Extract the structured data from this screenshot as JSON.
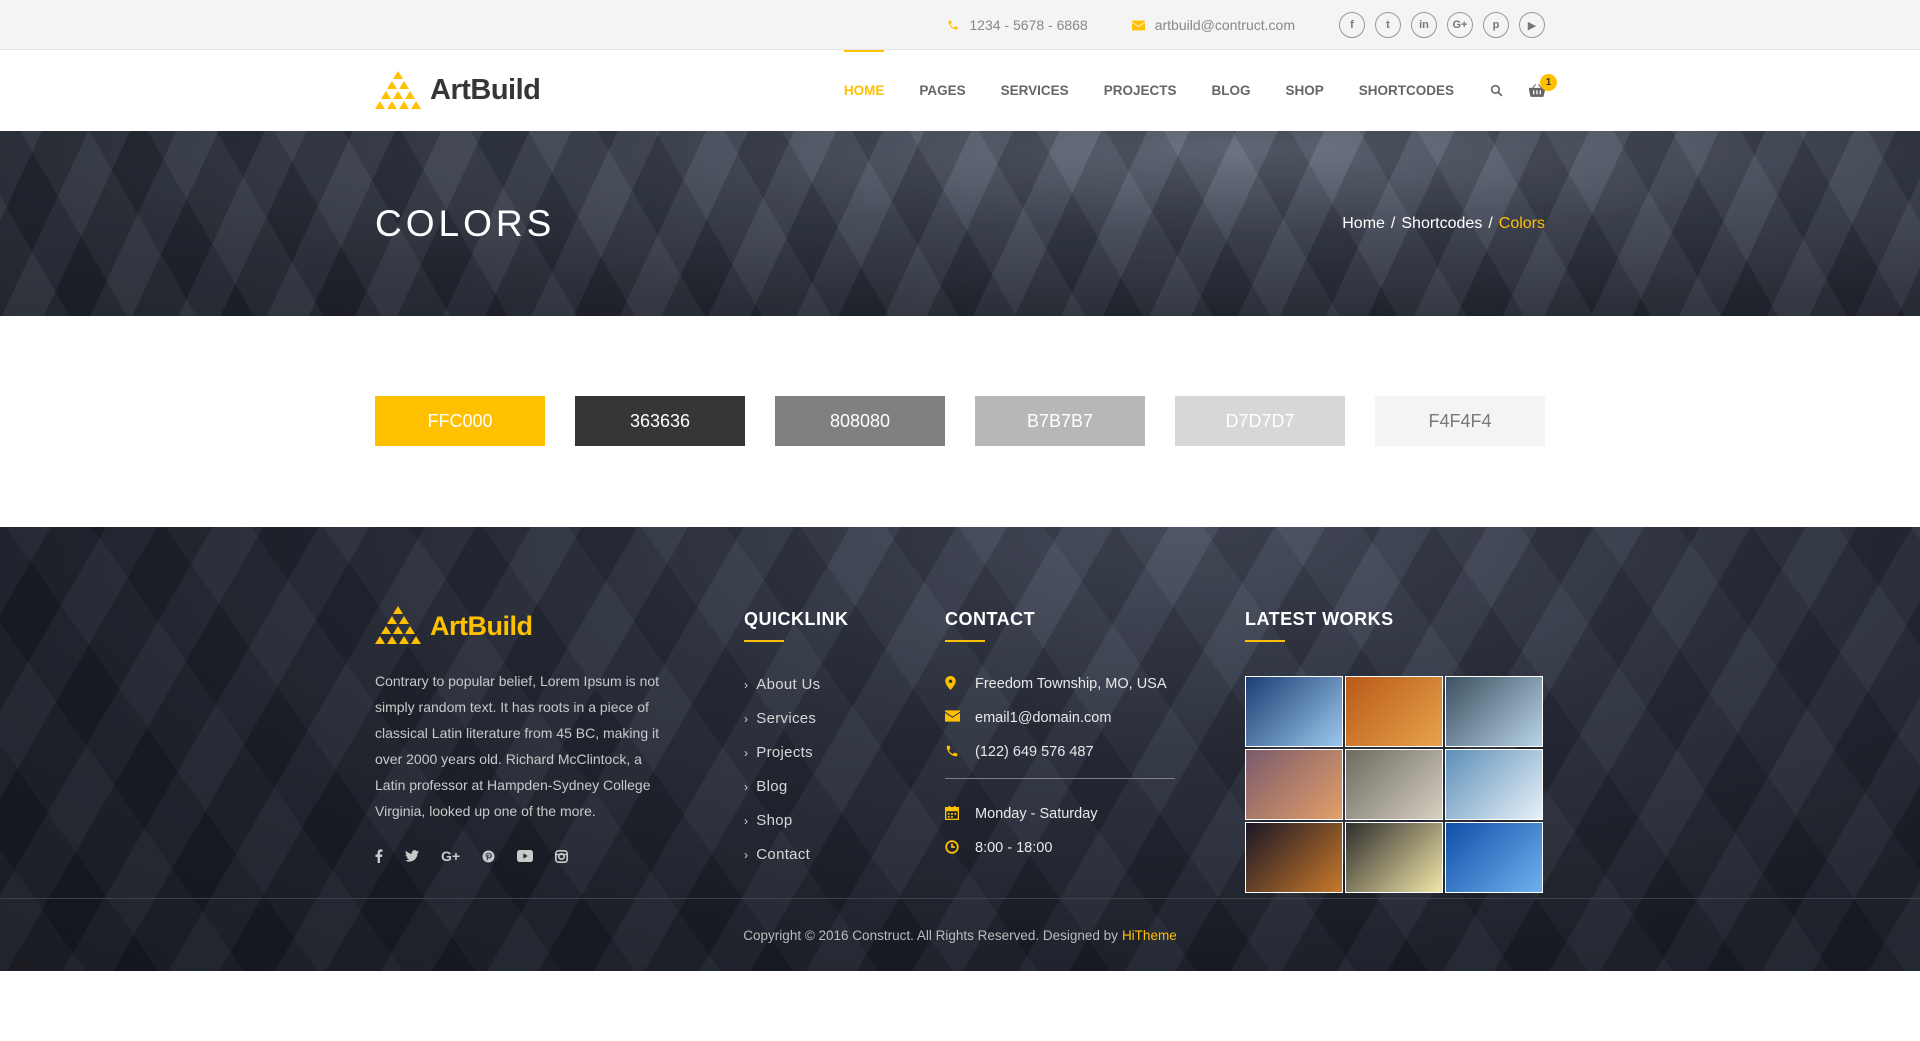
{
  "topbar": {
    "phone": "1234 - 5678 - 6868",
    "email": "artbuild@contruct.com",
    "socials": [
      {
        "icon": "facebook-icon",
        "glyph": "f"
      },
      {
        "icon": "twitter-icon",
        "glyph": "t"
      },
      {
        "icon": "linkedin-icon",
        "glyph": "in"
      },
      {
        "icon": "google-plus-icon",
        "glyph": "G+"
      },
      {
        "icon": "pinterest-icon",
        "glyph": "p"
      },
      {
        "icon": "youtube-icon",
        "glyph": "▶"
      }
    ]
  },
  "header": {
    "logo_text": "ArtBuild",
    "nav": [
      "HOME",
      "PAGES",
      "SERVICES",
      "PROJECTS",
      "BLOG",
      "SHOP",
      "SHORTCODES"
    ],
    "cart_count": "1"
  },
  "banner": {
    "title": "COLORS",
    "breadcrumb": {
      "home": "Home",
      "sep": "/",
      "parent": "Shortcodes",
      "current": "Colors"
    }
  },
  "swatches": [
    {
      "label": "FFC000",
      "color": "#FFC000",
      "text_color": "#ffffff"
    },
    {
      "label": "363636",
      "color": "#363636",
      "text_color": "#ffffff"
    },
    {
      "label": "808080",
      "color": "#808080",
      "text_color": "#ffffff"
    },
    {
      "label": "B7B7B7",
      "color": "#B7B7B7",
      "text_color": "#ffffff"
    },
    {
      "label": "D7D7D7",
      "color": "#D7D7D7",
      "text_color": "#ffffff"
    },
    {
      "label": "F4F4F4",
      "color": "#F4F4F4",
      "text_color": "#7a7a7a"
    }
  ],
  "footer": {
    "logo_text": "ArtBuild",
    "about": "Contrary to popular belief, Lorem Ipsum is not simply random text. It has roots in a piece of classical Latin literature from 45 BC, making it over 2000 years old. Richard McClintock, a Latin professor at Hampden-Sydney College Virginia, looked up one of the more.",
    "socials": [
      "facebook-icon",
      "twitter-icon",
      "google-plus-icon",
      "pinterest-icon",
      "youtube-icon",
      "instagram-icon"
    ],
    "quicklink": {
      "title": "QUICKLINK",
      "items": [
        "About Us",
        "Services",
        "Projects",
        "Blog",
        "Shop",
        "Contact"
      ]
    },
    "contact": {
      "title": "CONTACT",
      "address": "Freedom Township, MO, USA",
      "email": "email1@domain.com",
      "phone": "(122) 649 576 487",
      "days": "Monday - Saturday",
      "hours": "8:00 - 18:00"
    },
    "latest_works": {
      "title": "LATEST WORKS",
      "thumbs": [
        {
          "a": "#1b3f73",
          "b": "#9cc7ee"
        },
        {
          "a": "#b85a18",
          "b": "#e8a34c"
        },
        {
          "a": "#3c5160",
          "b": "#b8d3e8"
        },
        {
          "a": "#7a5a6c",
          "b": "#e3a068"
        },
        {
          "a": "#6e6a60",
          "b": "#d6d0c2"
        },
        {
          "a": "#5d8fb8",
          "b": "#e8f1f8"
        },
        {
          "a": "#1a1626",
          "b": "#c87a2a"
        },
        {
          "a": "#2e2d2c",
          "b": "#f2e7a8"
        },
        {
          "a": "#0f4fa8",
          "b": "#6fb1ee"
        }
      ]
    },
    "copyright": "Copyright © 2016 Construct. All Rights Reserved. Designed by",
    "copyright_brand": "HiTheme"
  }
}
